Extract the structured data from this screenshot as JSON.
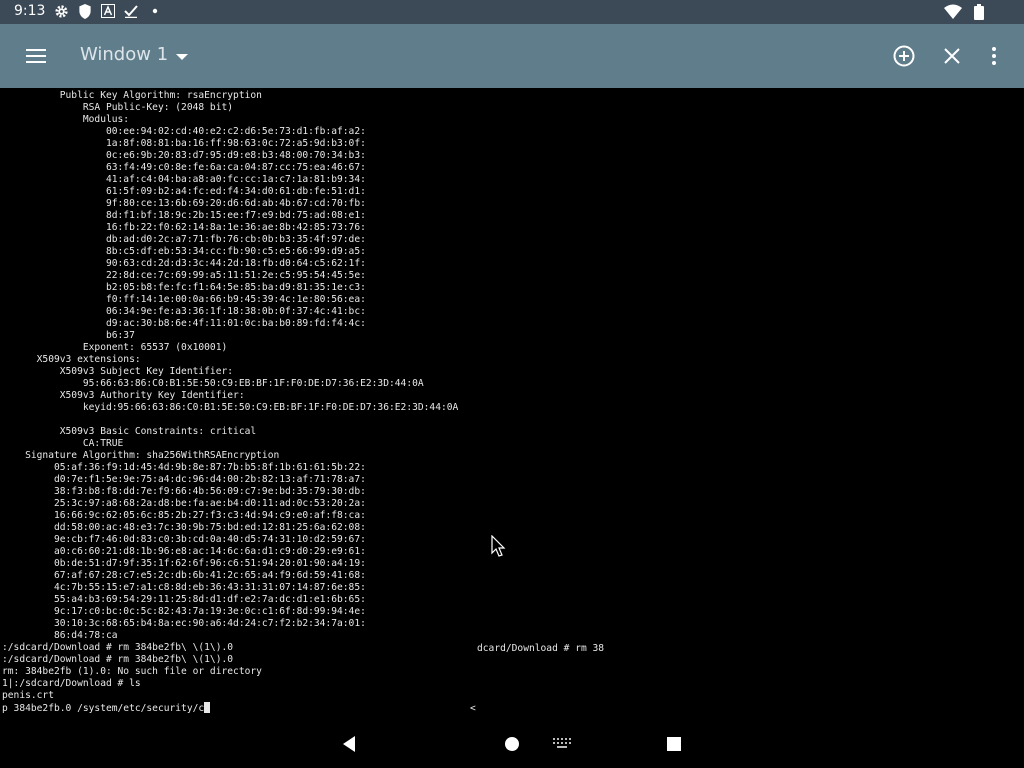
{
  "status_bar": {
    "time": "9:13",
    "icons": [
      "gear-icon",
      "shield-icon",
      "font-a-icon",
      "check-icon",
      "dot-icon",
      "wifi-icon",
      "battery-icon"
    ]
  },
  "app_bar": {
    "title": "Window 1",
    "color": "#607d8b",
    "icons": [
      "menu-icon",
      "dropdown-arrow-icon",
      "add-circle-icon",
      "close-icon",
      "more-vert-icon"
    ]
  },
  "terminal": {
    "text": "          Public Key Algorithm: rsaEncryption\n              RSA Public-Key: (2048 bit)\n              Modulus:\n                  00:ee:94:02:cd:40:e2:c2:d6:5e:73:d1:fb:af:a2:\n                  1a:8f:08:81:ba:16:ff:98:63:0c:72:a5:9d:b3:0f:\n                  0c:e6:9b:20:83:d7:95:d9:e8:b3:48:00:70:34:b3:\n                  63:f4:49:c0:8e:fe:6a:ca:04:87:cc:75:ea:46:67:\n                  41:af:c4:04:ba:a8:a0:fc:cc:1a:c7:1a:81:b9:34:\n                  61:5f:09:b2:a4:fc:ed:f4:34:d0:61:db:fe:51:d1:\n                  9f:80:ce:13:6b:69:20:d6:6d:ab:4b:67:cd:70:fb:\n                  8d:f1:bf:18:9c:2b:15:ee:f7:e9:bd:75:ad:08:e1:\n                  16:fb:22:f0:62:14:8a:1e:36:ae:8b:42:85:73:76:\n                  db:ad:d0:2c:a7:71:fb:76:cb:0b:b3:35:4f:97:de:\n                  8b:c5:df:eb:53:34:cc:fb:90:c5:e5:66:99:d9:a5:\n                  90:63:cd:2d:d3:3c:44:2d:18:fb:d0:64:c5:62:1f:\n                  22:8d:ce:7c:69:99:a5:11:51:2e:c5:95:54:45:5e:\n                  b2:05:b8:fe:fc:f1:64:5e:85:ba:d9:81:35:1e:c3:\n                  f0:ff:14:1e:00:0a:66:b9:45:39:4c:1e:80:56:ea:\n                  06:34:9e:fe:a3:36:1f:18:38:0b:0f:37:4c:41:bc:\n                  d9:ac:30:b8:6e:4f:11:01:0c:ba:b0:89:fd:f4:4c:\n                  b6:37\n              Exponent: 65537 (0x10001)\n      X509v3 extensions:\n          X509v3 Subject Key Identifier:\n              95:66:63:86:C0:B1:5E:50:C9:EB:BF:1F:F0:DE:D7:36:E2:3D:44:0A\n          X509v3 Authority Key Identifier:\n              keyid:95:66:63:86:C0:B1:5E:50:C9:EB:BF:1F:F0:DE:D7:36:E2:3D:44:0A\n\n          X509v3 Basic Constraints: critical\n              CA:TRUE\n    Signature Algorithm: sha256WithRSAEncryption\n         05:af:36:f9:1d:45:4d:9b:8e:87:7b:b5:8f:1b:61:61:5b:22:\n         d0:7e:f1:5e:9e:75:a4:dc:96:d4:00:2b:82:13:af:71:78:a7:\n         38:f3:b8:f8:dd:7e:f9:66:4b:56:09:c7:9e:bd:35:79:30:db:\n         25:3c:97:a8:68:2a:d8:be:fa:ae:b4:d0:11:ad:0c:53:20:2a:\n         16:66:9c:62:05:6c:85:2b:27:f3:c3:4d:94:c9:e0:af:f8:ca:\n         dd:58:00:ac:48:e3:7c:30:9b:75:bd:ed:12:81:25:6a:62:08:\n         9e:cb:f7:46:0d:83:c0:3b:cd:0a:40:d5:74:31:10:d2:59:67:\n         a0:c6:60:21:d8:1b:96:e8:ac:14:6c:6a:d1:c9:d0:29:e9:61:\n         0b:de:51:d7:9f:35:1f:62:6f:96:c6:51:94:20:01:90:a4:19:\n         67:af:67:28:c7:e5:2c:db:6b:41:2c:65:a4:f9:6d:59:41:68:\n         4c:7b:55:15:e7:a1:c8:8d:eb:36:43:31:31:07:14:87:6e:85:\n         55:a4:b3:69:54:29:11:25:8d:d1:df:e2:7a:dc:d1:e1:6b:65:\n         9c:17:c0:bc:0c:5c:82:43:7a:19:3e:0c:c1:6f:8d:99:94:4e:\n         30:10:3c:68:65:b4:8a:ec:90:a6:4d:24:c7:f2:b2:34:7a:01:\n         86:d4:78:ca\n:/sdcard/Download # rm 384be2fb\\ \\(1\\).0\n:/sdcard/Download # rm 384be2fb\\ \\(1\\).0\nrm: 384be2fb (1).0: No such file or directory\n1|:/sdcard/Download # ls\npenis.crt\np 384be2fb.0 /system/etc/security/c",
    "overlay_right": "dcard/Download # rm 38",
    "overlay_lt": "<"
  },
  "nav_bar": {
    "icons": [
      "back-icon",
      "home-icon",
      "keyboard-icon",
      "recents-icon"
    ]
  }
}
